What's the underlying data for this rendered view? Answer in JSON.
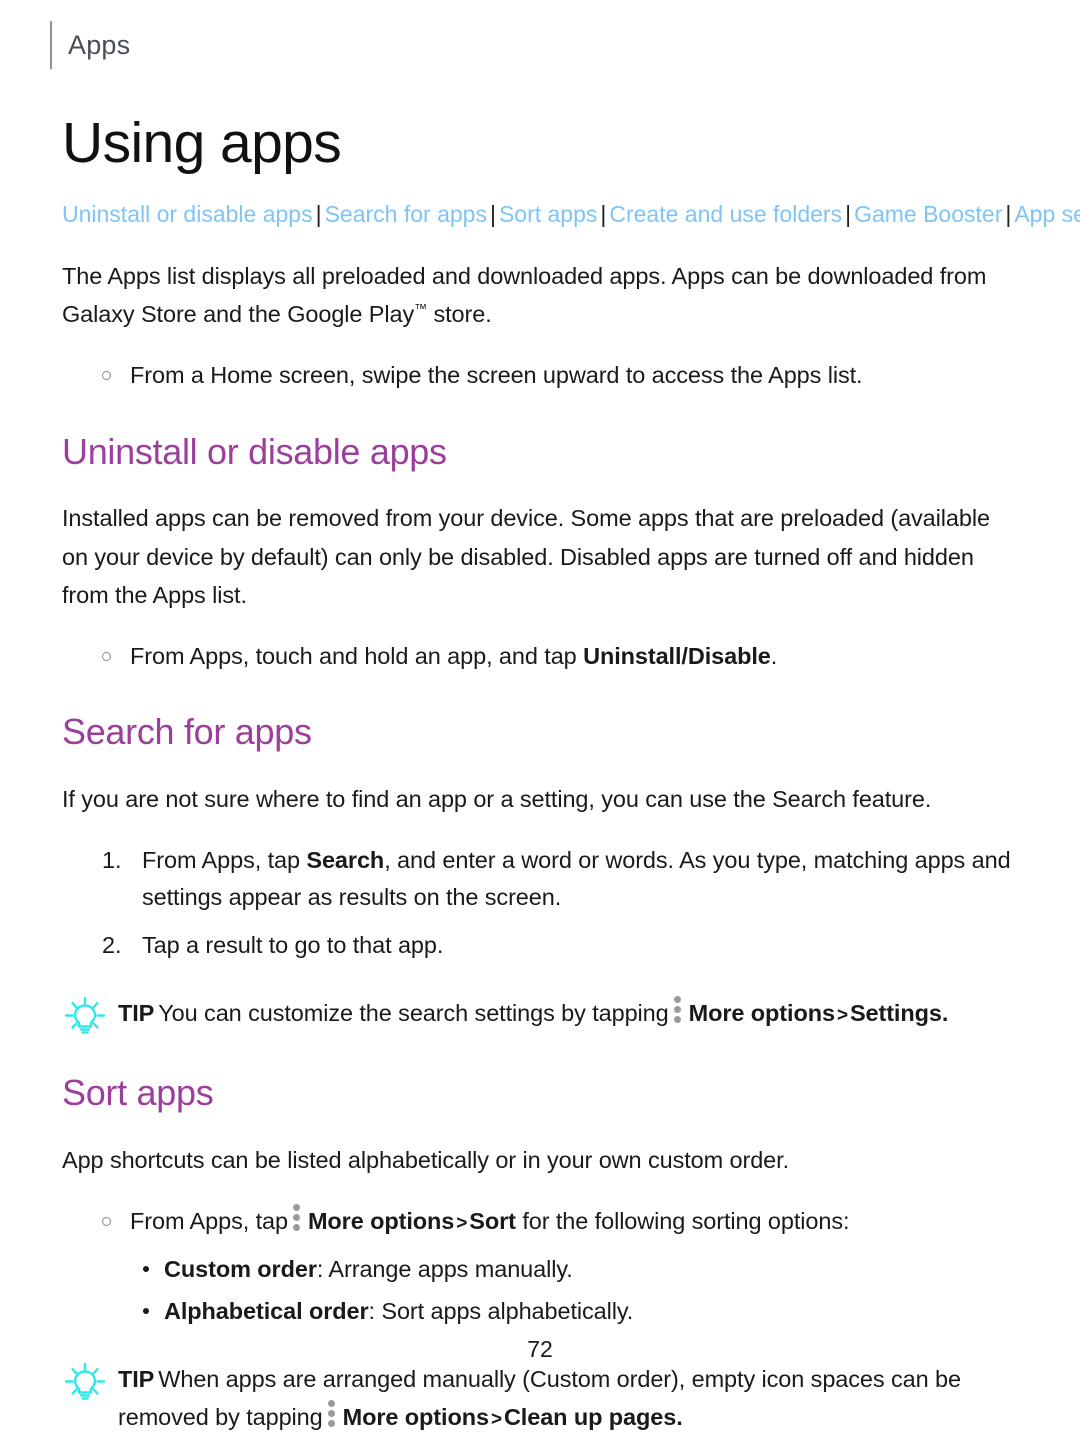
{
  "header": {
    "chapter_label": "Apps"
  },
  "title": "Using apps",
  "nav": {
    "separator": "|",
    "links": [
      "Uninstall or disable apps",
      "Search for apps",
      "Sort apps",
      "Create and use folders",
      "Game Booster",
      "App settings"
    ]
  },
  "intro": {
    "paragraph_part1": "The Apps list displays all preloaded and downloaded apps. Apps can be downloaded from Galaxy Store and the Google Play",
    "trademark": "™",
    "paragraph_part2": " store.",
    "bullet": "From a Home screen, swipe the screen upward to access the Apps list."
  },
  "uninstall_section": {
    "heading": "Uninstall or disable apps",
    "paragraph": "Installed apps can be removed from your device. Some apps that are preloaded (available on your device by default) can only be disabled. Disabled apps are turned off and hidden from the Apps list.",
    "bullet_prefix": "From Apps, touch and hold an app, and tap ",
    "bullet_bold": "Uninstall/Disable",
    "bullet_suffix": "."
  },
  "search_section": {
    "heading": "Search for apps",
    "paragraph": "If you are not sure where to find an app or a setting, you can use the Search feature.",
    "step1_prefix": "From Apps, tap ",
    "step1_bold": "Search",
    "step1_suffix": ", and enter a word or words. As you type, matching apps and settings appear as results on the screen.",
    "step2": "Tap a result to go to that app.",
    "tip_label": "TIP",
    "tip_prefix": "You can customize the search settings by tapping",
    "tip_more_options": "More options",
    "tip_chevron": ">",
    "tip_target": "Settings."
  },
  "sort_section": {
    "heading": "Sort apps",
    "paragraph": "App shortcuts can be listed alphabetically or in your own custom order.",
    "bullet_prefix": "From Apps, tap",
    "bullet_more_options": "More options",
    "bullet_chevron": ">",
    "bullet_sort": "Sort",
    "bullet_suffix": " for the following sorting options:",
    "options": [
      {
        "name": "Custom order",
        "desc": ": Arrange apps manually."
      },
      {
        "name": "Alphabetical order",
        "desc": ": Sort apps alphabetically."
      }
    ],
    "tip_label": "TIP",
    "tip_prefix": "When apps are arranged manually (Custom order), empty icon spaces can be removed by tapping",
    "tip_more_options": "More options",
    "tip_chevron": ">",
    "tip_target": "Clean up pages."
  },
  "footer": {
    "page_number": "72"
  },
  "icons": {
    "tip": "lightbulb-icon",
    "more_options": "more-options-kebab-icon"
  },
  "colors": {
    "heading_purple": "#9c3f9c",
    "link_blue": "#7fc4f5",
    "tip_cyan": "#2fe8e8",
    "kebab_gray": "#9a9a9a",
    "header_gray": "#4a4f56"
  }
}
